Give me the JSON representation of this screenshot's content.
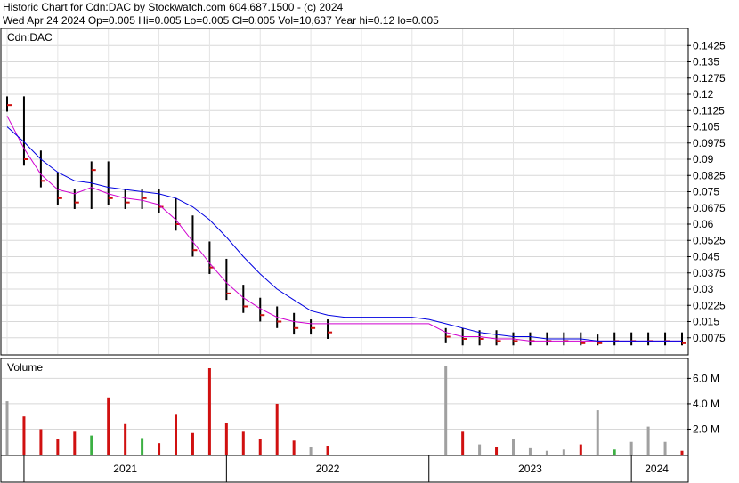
{
  "header": {
    "line1": "Historic Chart for Cdn:DAC by Stockwatch.com 604.687.1500 - (c) 2024",
    "line2": "Wed Apr 24 2024   Op=0.005  Hi=0.005  Lo=0.005  Cl=0.005  Vol=10,637  Year hi=0.12  lo=0.005"
  },
  "chart_data": [
    {
      "type": "ohlc",
      "title": "Cdn:DAC",
      "y_ticks": [
        "0.1425",
        "0.135",
        "0.1275",
        "0.12",
        "0.1125",
        "0.105",
        "0.0975",
        "0.09",
        "0.0825",
        "0.075",
        "0.0675",
        "0.06",
        "0.0525",
        "0.045",
        "0.0375",
        "0.03",
        "0.0225",
        "0.015",
        "0.0075"
      ],
      "ylim": [
        0,
        0.15
      ],
      "grid": true,
      "x": [
        "2020-12",
        "2021-01",
        "2021-02",
        "2021-03",
        "2021-04",
        "2021-05",
        "2021-06",
        "2021-07",
        "2021-08",
        "2021-09",
        "2021-10",
        "2021-11",
        "2021-12",
        "2022-01",
        "2022-02",
        "2022-03",
        "2022-04",
        "2022-05",
        "2022-06",
        "2022-07",
        "2022-08",
        "2022-09",
        "2022-10",
        "2022-11",
        "2022-12",
        "2023-01",
        "2023-02",
        "2023-03",
        "2023-04",
        "2023-05",
        "2023-06",
        "2023-07",
        "2023-08",
        "2023-09",
        "2023-10",
        "2023-11",
        "2023-12",
        "2024-01",
        "2024-02",
        "2024-03",
        "2024-04"
      ],
      "close": [
        0.115,
        0.09,
        0.08,
        0.072,
        0.07,
        0.085,
        0.072,
        0.07,
        0.072,
        0.068,
        0.06,
        0.048,
        0.04,
        0.028,
        0.022,
        0.018,
        0.015,
        0.012,
        0.012,
        0.01,
        null,
        null,
        null,
        null,
        null,
        null,
        0.008,
        0.007,
        0.007,
        0.006,
        0.006,
        0.006,
        0.006,
        0.006,
        0.005,
        0.005,
        0.006,
        0.006,
        0.006,
        0.006,
        0.005
      ],
      "series": [
        {
          "name": "",
          "color": "#d000d0",
          "values": [
            0.11,
            0.095,
            0.083,
            0.076,
            0.074,
            0.077,
            0.074,
            0.072,
            0.071,
            0.069,
            0.062,
            0.052,
            0.042,
            0.033,
            0.026,
            0.021,
            0.017,
            0.015,
            0.014,
            0.014,
            0.014,
            0.014,
            0.014,
            0.014,
            0.014,
            0.014,
            0.01,
            0.008,
            0.008,
            0.007,
            0.007,
            0.006,
            0.006,
            0.006,
            0.006,
            0.006,
            0.006,
            0.006,
            0.006,
            0.006,
            0.006
          ]
        },
        {
          "name": "",
          "color": "#0000e0",
          "values": [
            0.105,
            0.098,
            0.09,
            0.084,
            0.08,
            0.079,
            0.077,
            0.076,
            0.075,
            0.074,
            0.072,
            0.068,
            0.062,
            0.054,
            0.045,
            0.037,
            0.03,
            0.025,
            0.02,
            0.018,
            0.017,
            0.017,
            0.017,
            0.017,
            0.017,
            0.016,
            0.014,
            0.012,
            0.01,
            0.009,
            0.008,
            0.008,
            0.007,
            0.007,
            0.007,
            0.006,
            0.006,
            0.006,
            0.006,
            0.006,
            0.006
          ]
        }
      ]
    },
    {
      "type": "bar",
      "title": "Volume",
      "y_ticks": [
        "6.0 M",
        "4.0 M",
        "2.0 M"
      ],
      "ylim": [
        0,
        7500000
      ],
      "x": [
        "2020-12",
        "2021-01",
        "2021-02",
        "2021-03",
        "2021-04",
        "2021-05",
        "2021-06",
        "2021-07",
        "2021-08",
        "2021-09",
        "2021-10",
        "2021-11",
        "2021-12",
        "2022-01",
        "2022-02",
        "2022-03",
        "2022-04",
        "2022-05",
        "2022-06",
        "2022-07",
        "2022-08",
        "2022-09",
        "2022-10",
        "2022-11",
        "2022-12",
        "2023-01",
        "2023-02",
        "2023-03",
        "2023-04",
        "2023-05",
        "2023-06",
        "2023-07",
        "2023-08",
        "2023-09",
        "2023-10",
        "2023-11",
        "2023-12",
        "2024-01",
        "2024-02",
        "2024-03",
        "2024-04"
      ],
      "values": [
        4200000,
        3000000,
        2000000,
        1200000,
        1800000,
        1500000,
        4500000,
        2400000,
        1300000,
        900000,
        3200000,
        1700000,
        6800000,
        2500000,
        1800000,
        1200000,
        4000000,
        1100000,
        600000,
        700000,
        0,
        0,
        0,
        0,
        0,
        0,
        7000000,
        1800000,
        800000,
        600000,
        1200000,
        500000,
        300000,
        400000,
        800000,
        3500000,
        400000,
        1000000,
        2200000,
        1000000,
        300000
      ],
      "colors": {
        "up": "#3cb043",
        "down": "#d01010",
        "flat": "#a0a0a0"
      }
    }
  ],
  "x_axis": {
    "years": [
      "2021",
      "2022",
      "2023",
      "2024"
    ]
  }
}
